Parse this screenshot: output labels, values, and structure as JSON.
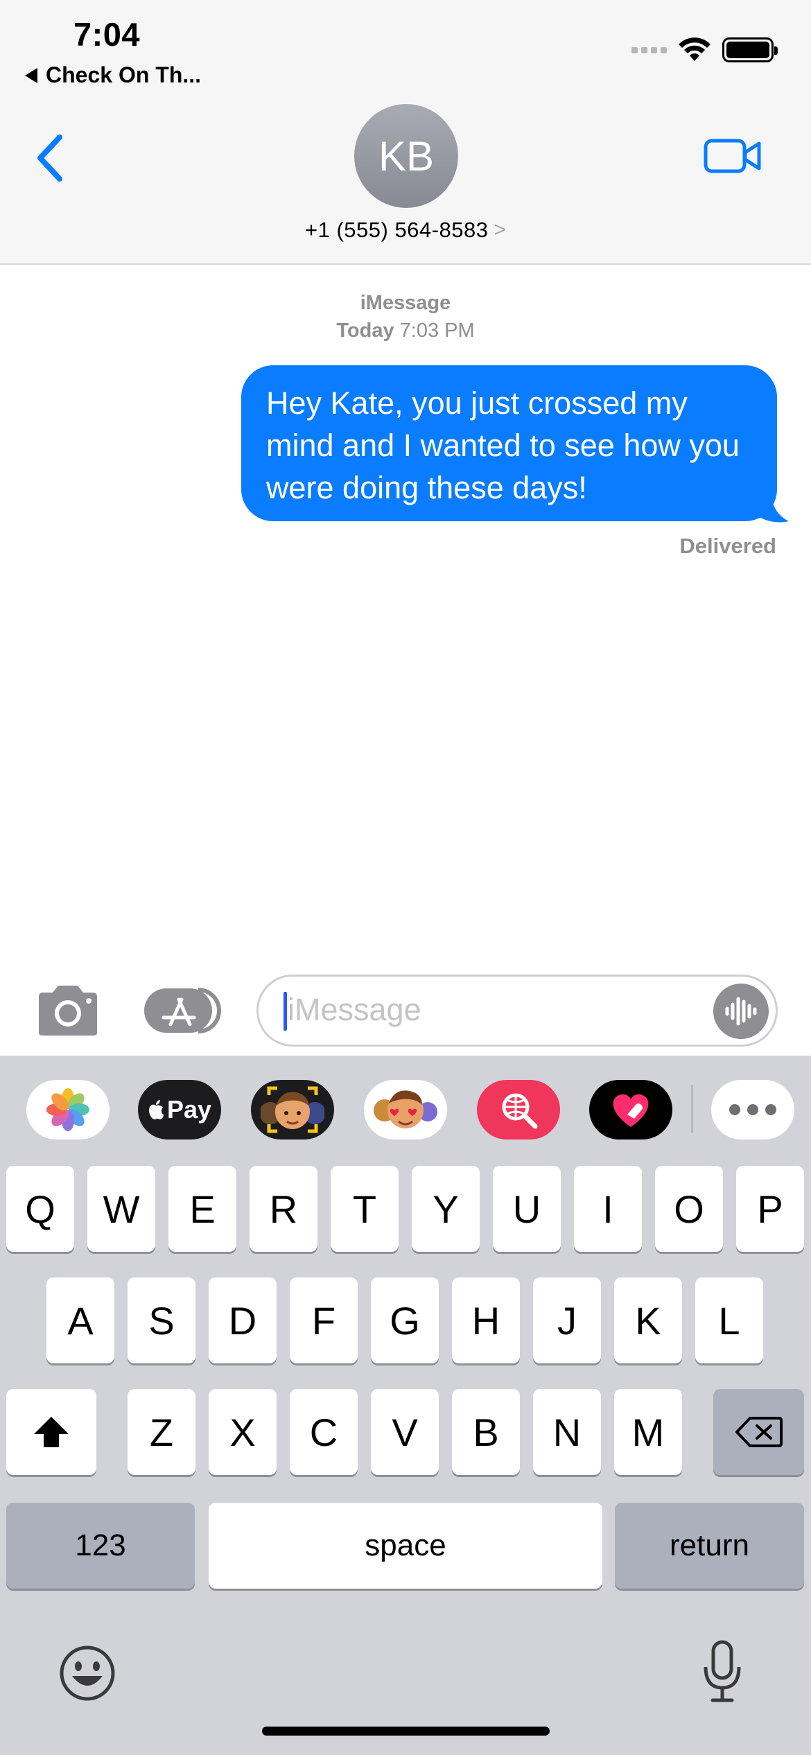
{
  "status_bar": {
    "time": "7:04",
    "back_app": "Check On Th..."
  },
  "header": {
    "avatar_initials": "KB",
    "contact": "+1 (555) 564-8583",
    "chevron": ">"
  },
  "conversation": {
    "service": "iMessage",
    "timestamp_day": "Today",
    "timestamp_time": "7:03 PM",
    "messages": [
      {
        "direction": "outgoing",
        "text": "Hey Kate, you just crossed my mind and I wanted to see how you were doing these days!",
        "status": "Delivered"
      }
    ]
  },
  "compose": {
    "placeholder": "iMessage"
  },
  "app_drawer": [
    {
      "name": "photos-app-icon"
    },
    {
      "name": "apple-pay-app-icon",
      "label": "Pay"
    },
    {
      "name": "memoji-camera-app-icon"
    },
    {
      "name": "memoji-stickers-app-icon"
    },
    {
      "name": "images-search-app-icon"
    },
    {
      "name": "digital-touch-app-icon"
    },
    {
      "name": "more-apps-icon"
    }
  ],
  "keyboard": {
    "row1": [
      "Q",
      "W",
      "E",
      "R",
      "T",
      "Y",
      "U",
      "I",
      "O",
      "P"
    ],
    "row2": [
      "A",
      "S",
      "D",
      "F",
      "G",
      "H",
      "J",
      "K",
      "L"
    ],
    "row3": [
      "Z",
      "X",
      "C",
      "V",
      "B",
      "N",
      "M"
    ],
    "numbers_label": "123",
    "space_label": "space",
    "return_label": "return"
  },
  "colors": {
    "accent": "#0a7cff",
    "keyboard_bg": "#d1d3d9",
    "header_bg": "#f6f6f6"
  }
}
